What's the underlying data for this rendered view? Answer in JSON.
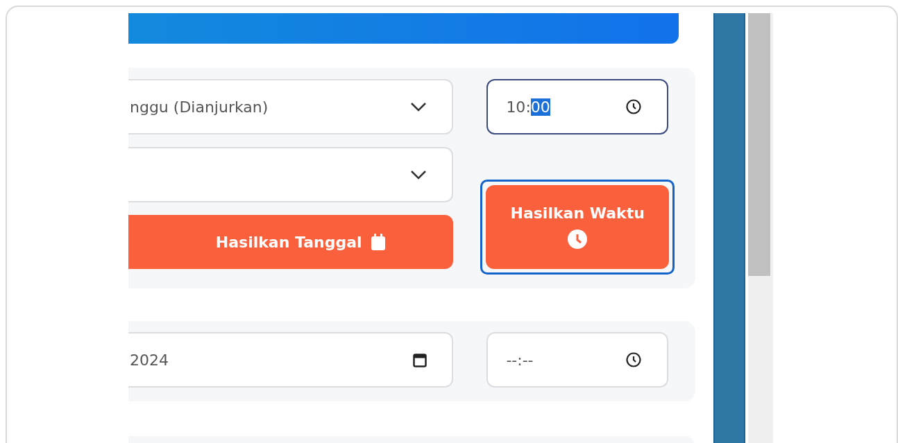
{
  "form": {
    "time_picker": {
      "hours": "10",
      "separator": ":",
      "minutes": "00",
      "minutes_selected": true,
      "focused": true
    },
    "selects": [
      {
        "kind": "filled",
        "value": "nggu (Dianjurkan)"
      },
      {
        "kind": "blank"
      }
    ],
    "generate_date_button": {
      "label": "Hasilkan Tanggal"
    },
    "generate_time_button": {
      "label": "Hasilkan Waktu",
      "focused": true
    }
  },
  "result": {
    "date_value": "2024",
    "time_value": "--:--"
  }
}
